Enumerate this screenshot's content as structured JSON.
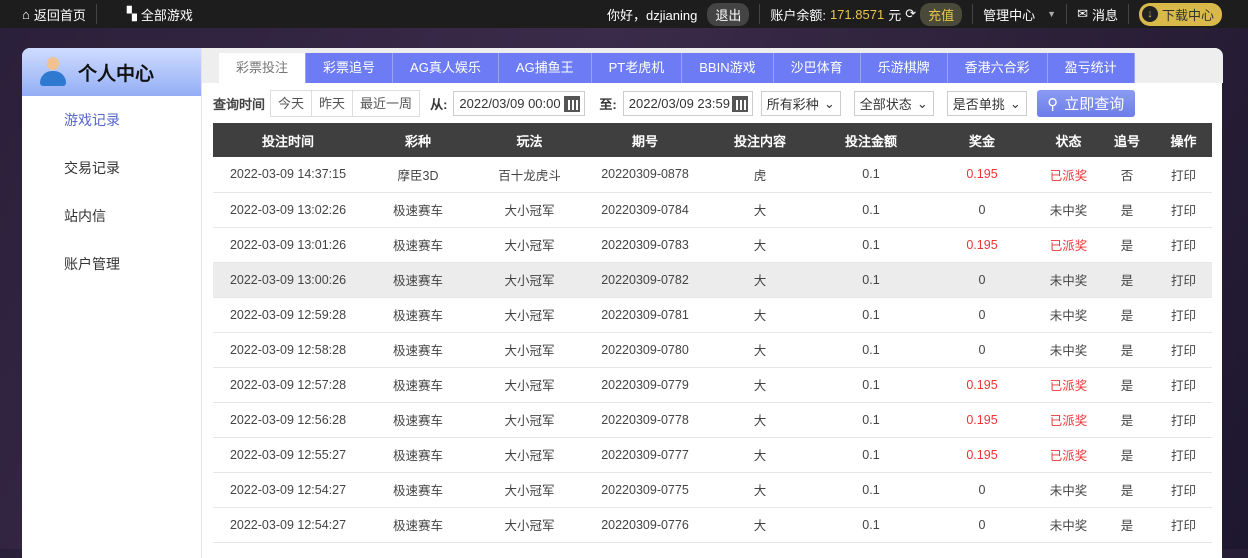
{
  "topbar": {
    "home": "返回首页",
    "all_games": "全部游戏",
    "greeting": "你好，dzjianing",
    "logout": "退出",
    "balance_label": "账户余额:",
    "balance": "171.8571",
    "currency": "元",
    "recharge": "充值",
    "manage": "管理中心",
    "messages": "消息",
    "download": "下载中心"
  },
  "sidebar": {
    "title": "个人中心",
    "items": [
      "游戏记录",
      "交易记录",
      "站内信",
      "账户管理"
    ]
  },
  "tabs": [
    "彩票投注",
    "彩票追号",
    "AG真人娱乐",
    "AG捕鱼王",
    "PT老虎机",
    "BBIN游戏",
    "沙巴体育",
    "乐游棋牌",
    "香港六合彩",
    "盈亏统计"
  ],
  "filter": {
    "label": "查询时间",
    "quick": [
      "今天",
      "昨天",
      "最近一周"
    ],
    "from_label": "从:",
    "from": "2022/03/09 00:00",
    "to_label": "至:",
    "to": "2022/03/09 23:59",
    "lottery": "所有彩种",
    "status": "全部状态",
    "single": "是否单挑",
    "query": "立即查询"
  },
  "table": {
    "headers": [
      "投注时间",
      "彩种",
      "玩法",
      "期号",
      "投注内容",
      "投注金额",
      "奖金",
      "状态",
      "追号",
      "操作"
    ],
    "rows": [
      [
        "2022-03-09 14:37:15",
        "摩臣3D",
        "百十龙虎斗",
        "20220309-0878",
        "虎",
        "0.1",
        "0.195",
        "已派奖",
        "否",
        "打印"
      ],
      [
        "2022-03-09 13:02:26",
        "极速赛车",
        "大小冠军",
        "20220309-0784",
        "大",
        "0.1",
        "0",
        "未中奖",
        "是",
        "打印"
      ],
      [
        "2022-03-09 13:01:26",
        "极速赛车",
        "大小冠军",
        "20220309-0783",
        "大",
        "0.1",
        "0.195",
        "已派奖",
        "是",
        "打印"
      ],
      [
        "2022-03-09 13:00:26",
        "极速赛车",
        "大小冠军",
        "20220309-0782",
        "大",
        "0.1",
        "0",
        "未中奖",
        "是",
        "打印"
      ],
      [
        "2022-03-09 12:59:28",
        "极速赛车",
        "大小冠军",
        "20220309-0781",
        "大",
        "0.1",
        "0",
        "未中奖",
        "是",
        "打印"
      ],
      [
        "2022-03-09 12:58:28",
        "极速赛车",
        "大小冠军",
        "20220309-0780",
        "大",
        "0.1",
        "0",
        "未中奖",
        "是",
        "打印"
      ],
      [
        "2022-03-09 12:57:28",
        "极速赛车",
        "大小冠军",
        "20220309-0779",
        "大",
        "0.1",
        "0.195",
        "已派奖",
        "是",
        "打印"
      ],
      [
        "2022-03-09 12:56:28",
        "极速赛车",
        "大小冠军",
        "20220309-0778",
        "大",
        "0.1",
        "0.195",
        "已派奖",
        "是",
        "打印"
      ],
      [
        "2022-03-09 12:55:27",
        "极速赛车",
        "大小冠军",
        "20220309-0777",
        "大",
        "0.1",
        "0.195",
        "已派奖",
        "是",
        "打印"
      ],
      [
        "2022-03-09 12:54:27",
        "极速赛车",
        "大小冠军",
        "20220309-0775",
        "大",
        "0.1",
        "0",
        "未中奖",
        "是",
        "打印"
      ],
      [
        "2022-03-09 12:54:27",
        "极速赛车",
        "大小冠军",
        "20220309-0776",
        "大",
        "0.1",
        "0",
        "未中奖",
        "是",
        "打印"
      ]
    ]
  }
}
